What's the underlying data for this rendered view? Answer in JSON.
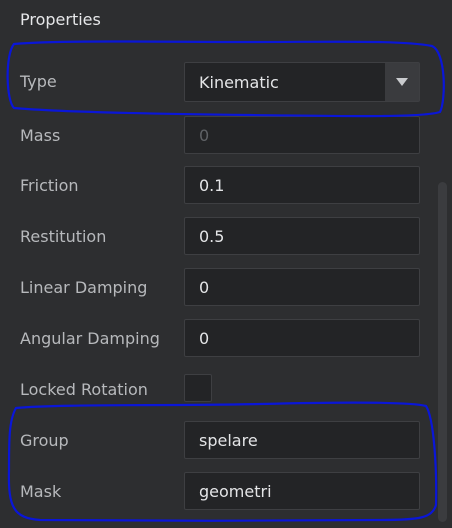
{
  "panel": {
    "title": "Properties"
  },
  "fields": {
    "type": {
      "label": "Type",
      "value": "Kinematic"
    },
    "mass": {
      "label": "Mass",
      "value": "0"
    },
    "friction": {
      "label": "Friction",
      "value": "0.1"
    },
    "restitution": {
      "label": "Restitution",
      "value": "0.5"
    },
    "linear_damping": {
      "label": "Linear Damping",
      "value": "0"
    },
    "angular_damping": {
      "label": "Angular Damping",
      "value": "0"
    },
    "locked_rotation": {
      "label": "Locked Rotation",
      "checked": false
    },
    "group": {
      "label": "Group",
      "value": "spelare"
    },
    "mask": {
      "label": "Mask",
      "value": "geometri"
    }
  },
  "icons": {
    "dropdown": "triangle-down-icon"
  },
  "colors": {
    "background": "#2d2e30",
    "field_background": "#232426",
    "annotation": "#0a16d8"
  }
}
